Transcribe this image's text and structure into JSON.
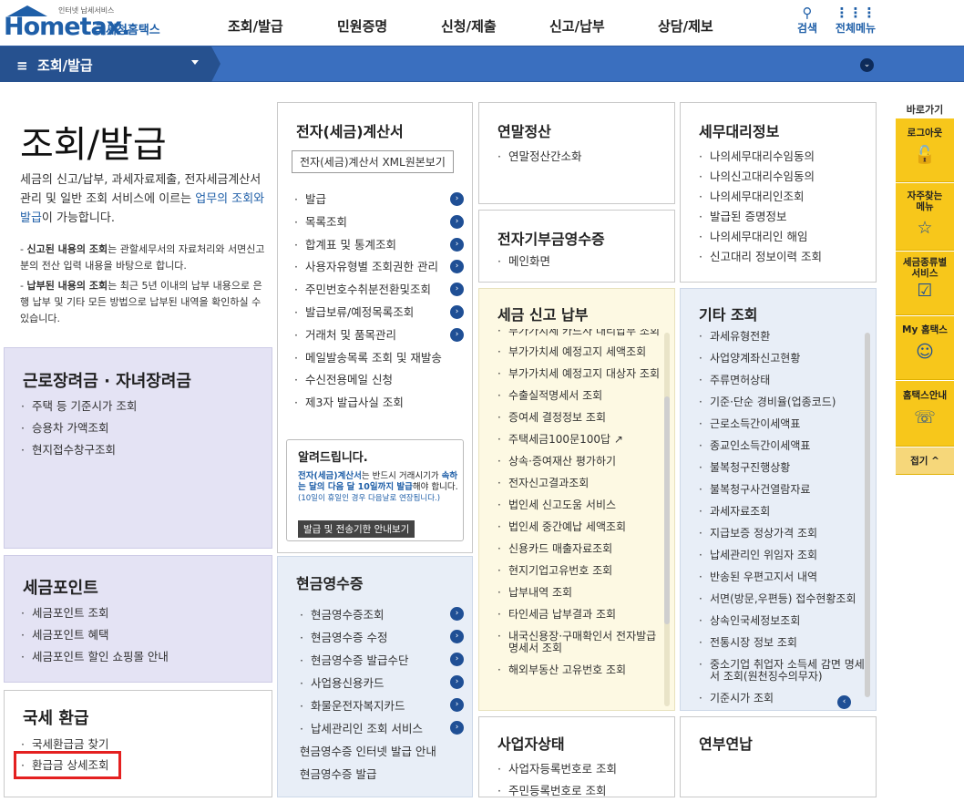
{
  "header": {
    "logo_small": "인터넷 납세서비스",
    "logo_brand": "Hometax.",
    "logo_kor": "국세청홈택스",
    "nav": [
      "조회/발급",
      "민원증명",
      "신청/제출",
      "신고/납부",
      "상담/제보"
    ],
    "search": "검색",
    "all_menu": "전체메뉴"
  },
  "breadcrumb": {
    "selected": "조회/발급"
  },
  "intro": {
    "title": "조회/발급",
    "desc_pre": "세금의 신고/납부, 과세자료제출, 전자세금계산서 관리 및 일반 조회 서비스에 이르는 ",
    "desc_hl": "업무의 조회와 발급",
    "desc_post": "이 가능합니다.",
    "note1_bold": "신고된 내용의 조회",
    "note1_rest": "는 관할세무서의 자료처리와 서면신고분의 전산 입력 내용을 바탕으로 합니다.",
    "note2_bold": "납부된 내용의 조회",
    "note2_rest": "는 최근 5년 이내의 납부 내용으로 은행 납부 및 기타 모든 방법으로 납부된 내역을 확인하실 수 있습니다."
  },
  "sections": {
    "labor": {
      "title": "근로장려금 · 자녀장려금",
      "items": [
        "주택 등 기준시가 조회",
        "승용차 가액조회",
        "현지접수창구조회"
      ]
    },
    "point": {
      "title": "세금포인트",
      "items": [
        "세금포인트 조회",
        "세금포인트 혜택",
        "세금포인트 할인 쇼핑몰 안내"
      ]
    },
    "refund": {
      "title": "국세 환급",
      "items": [
        "국세환급금 찾기",
        "환급금 상세조회"
      ]
    },
    "einvoice": {
      "title": "전자(세금)계산서",
      "button": "전자(세금)계산서 XML원본보기",
      "items": [
        "발급",
        "목록조회",
        "합계표 및 통계조회",
        "사용자유형별 조회권한 관리",
        "주민번호수취분전환및조회",
        "발급보류/예정목록조회",
        "거래처 및 품목관리",
        "메일발송목록 조회 및 재발송",
        "수신전용메일 신청",
        "제3자 발급사실 조회"
      ]
    },
    "notice": {
      "title": "알려드립니다.",
      "msg_a": "전자(세금)계산서",
      "msg_b": "는 반드시 거래시기가 ",
      "msg_c": "속하는 달의 다음 달 10일까지 발급",
      "msg_d": "해야 합니다.",
      "msg_sub": "(10일이 휴일인 경우 다음날로 연장됩니다.)",
      "button": "발급 및 전송기한 안내보기"
    },
    "cash": {
      "title": "현금영수증",
      "items": [
        "현금영수증조회",
        "현금영수증 수정",
        "현금영수증 발급수단",
        "사업용신용카드",
        "화물운전자복지카드",
        "납세관리인 조회 서비스",
        "현금영수증 인터넷 발급 안내",
        "현금영수증 발급"
      ]
    },
    "yearend": {
      "title": "연말정산",
      "items": [
        "연말정산간소화"
      ]
    },
    "donation": {
      "title": "전자기부금영수증",
      "items": [
        "메인화면"
      ]
    },
    "tax": {
      "title": "세금 신고 납부",
      "items": [
        "부가가치세 카드사 대리납부 조회",
        "부가가치세 예정고지 세액조회",
        "부가가치세 예정고지 대상자 조회",
        "수출실적명세서 조회",
        "증여세 결정정보 조회",
        "주택세금100문100답",
        "상속·증여재산 평가하기",
        "전자신고결과조회",
        "법인세 신고도움 서비스",
        "법인세 중간예납 세액조회",
        "신용카드 매출자료조회",
        "현지기업고유번호 조회",
        "납부내역 조회",
        "타인세금 납부결과 조회",
        "내국신용장·구매확인서 전자발급명세서 조회",
        "해외부동산 고유번호 조회"
      ]
    },
    "business": {
      "title": "사업자상태",
      "items": [
        "사업자등록번호로 조회",
        "주민등록번호로 조회"
      ]
    },
    "agent": {
      "title": "세무대리정보",
      "items": [
        "나의세무대리수임동의",
        "나의신고대리수임동의",
        "나의세무대리인조회",
        "발급된 증명정보",
        "나의세무대리인 해임",
        "신고대리 정보이력 조회"
      ]
    },
    "etc": {
      "title": "기타 조회",
      "items": [
        "과세유형전환",
        "사업양계좌신고현황",
        "주류면허상태",
        "기준·단순 경비율(업종코드)",
        "근로소득간이세액표",
        "종교인소득간이세액표",
        "불복청구진행상황",
        "불복청구사건열람자료",
        "과세자료조회",
        "지급보증 정상가격 조회",
        "납세관리인 위임자 조회",
        "반송된 우편고지서 내역",
        "서면(방문,우편등) 접수현황조회",
        "상속인국세정보조회",
        "전통시장 정보 조회",
        "중소기업 취업자 소득세 감면 명세서 조회(원천징수의무자)",
        "기준시가 조회"
      ]
    },
    "settle": {
      "title": "연부연납"
    }
  },
  "quick": {
    "title": "바로가기",
    "items": [
      {
        "label": "로그아웃",
        "icon": "logout-icon"
      },
      {
        "label": "자주찾는 메뉴",
        "icon": "star-icon"
      },
      {
        "label": "세금종류별 서비스",
        "icon": "check-box-icon"
      },
      {
        "label": "My 홈택스",
        "icon": "user-icon"
      },
      {
        "label": "홈택스안내",
        "icon": "guide-icon"
      }
    ],
    "fold": "접기"
  }
}
